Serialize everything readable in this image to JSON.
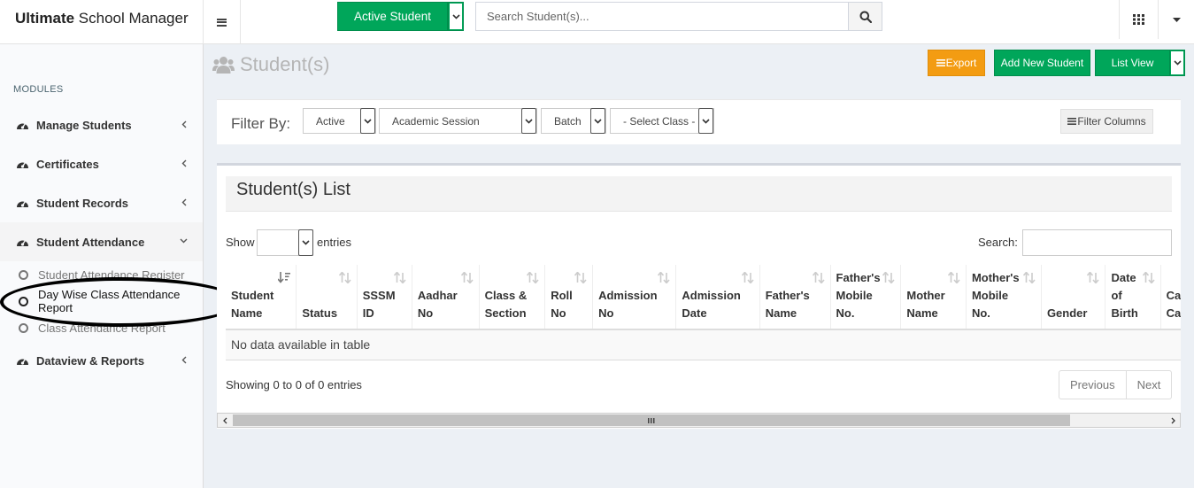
{
  "brand": {
    "bold": "Ultimate",
    "rest": " School Manager"
  },
  "topbar": {
    "active_student_label": "Active Student",
    "search_placeholder": "Search Student(s)..."
  },
  "sidebar": {
    "header": "MODULES",
    "items": [
      {
        "label": "Manage Students"
      },
      {
        "label": "Certificates"
      },
      {
        "label": "Student Records"
      },
      {
        "label": "Student Attendance"
      },
      {
        "label": "Dataview & Reports"
      }
    ],
    "sub_items": [
      {
        "label": "Student Attendance Register"
      },
      {
        "label": "Day Wise Class Attendance Report"
      },
      {
        "label": "Class Attendance Report"
      }
    ]
  },
  "page": {
    "title": "Student(s)",
    "export_label": "Export",
    "add_new_label": "Add New Student",
    "list_view_label": "List View"
  },
  "filter": {
    "label": "Filter By:",
    "status": "Active",
    "session": "Academic Session",
    "batch": "Batch",
    "class": "- Select Class -",
    "filter_columns_label": "Filter Columns"
  },
  "list": {
    "title": "Student(s) List",
    "show_label": "Show",
    "entries_label": "entries",
    "search_label": "Search:",
    "columns": [
      [
        "Student",
        "Name"
      ],
      [
        "Status"
      ],
      [
        "SSSM",
        "ID"
      ],
      [
        "Aadhar",
        "No"
      ],
      [
        "Class &",
        "Section"
      ],
      [
        "Roll",
        "No"
      ],
      [
        "Admission",
        "No"
      ],
      [
        "Admission",
        "Date"
      ],
      [
        "Father's",
        "Name"
      ],
      [
        "Father's",
        "Mobile",
        "No."
      ],
      [
        "Mother",
        "Name"
      ],
      [
        "Mother's",
        "Mobile",
        "No."
      ],
      [
        "Gender"
      ],
      [
        "Date",
        "of",
        "Birth"
      ],
      [
        "Caste",
        "Category"
      ]
    ],
    "empty_text": "No data available in table",
    "showing_text": "Showing 0 to 0 of 0 entries",
    "previous_label": "Previous",
    "next_label": "Next"
  },
  "colors": {
    "green": "#00a65a",
    "orange": "#f39c12",
    "bg": "#ecf0f5"
  }
}
